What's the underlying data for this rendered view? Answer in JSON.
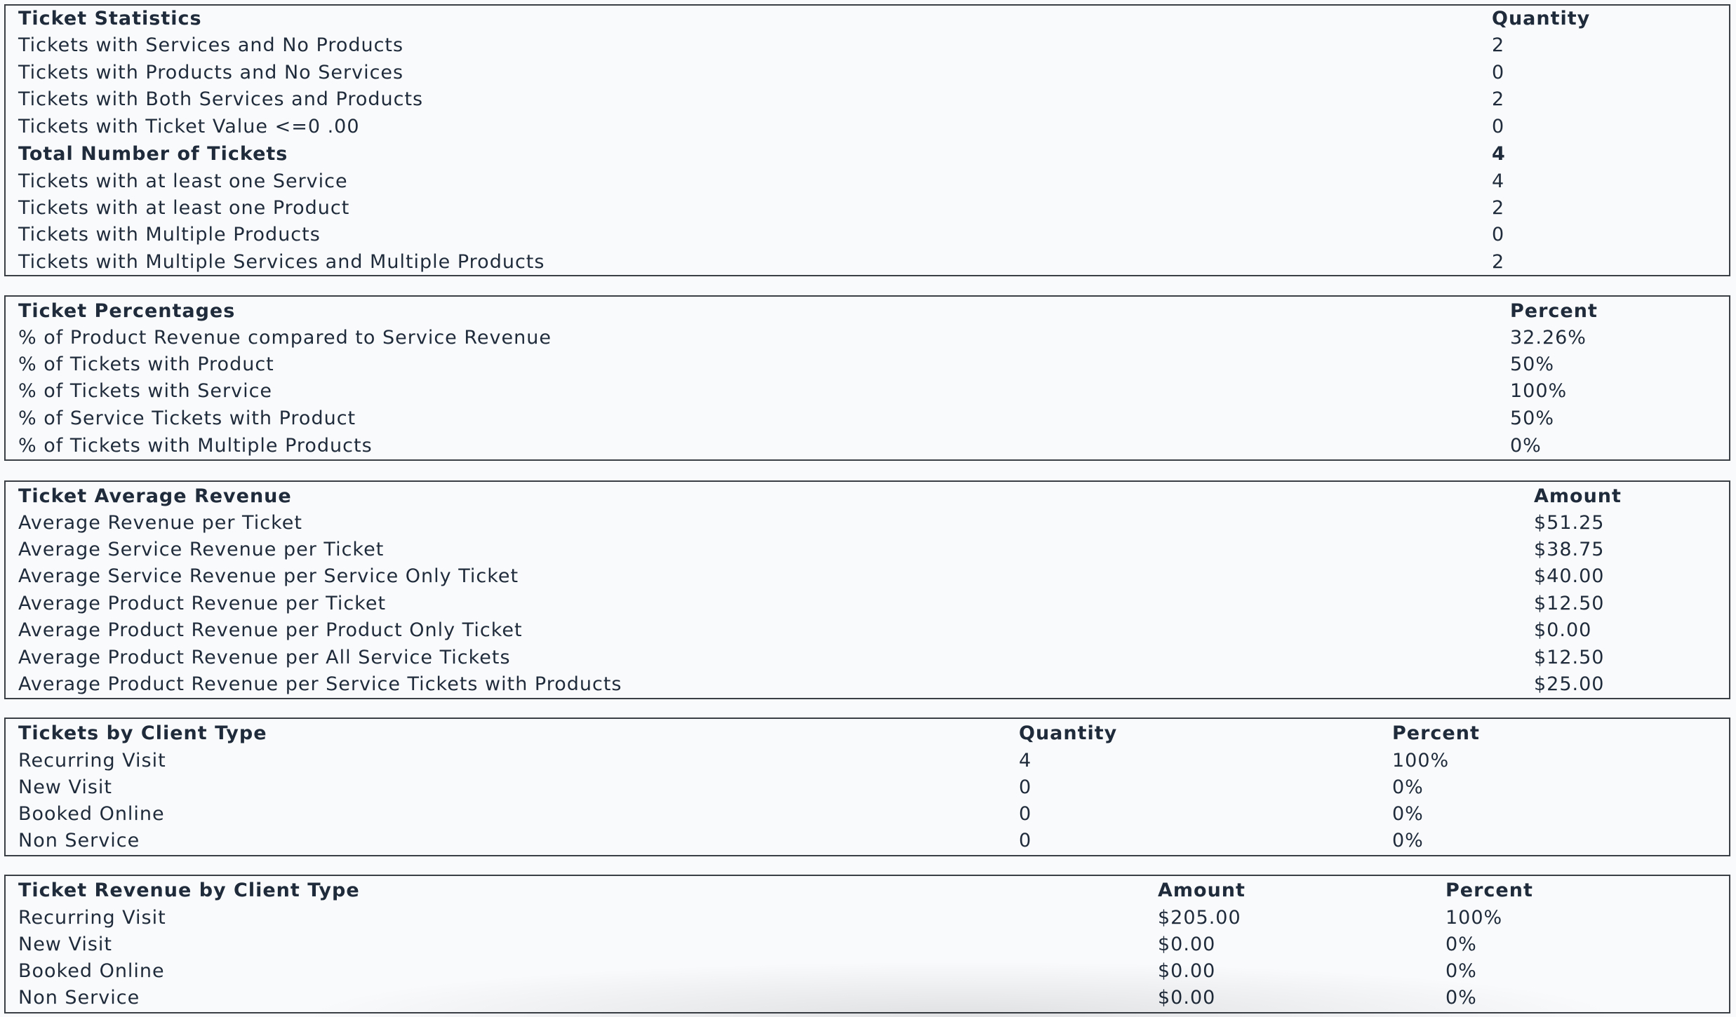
{
  "ticket_statistics": {
    "header": {
      "label": "Ticket Statistics",
      "value": "Quantity"
    },
    "rows": [
      {
        "label": "Tickets with Services and No Products",
        "value": "2"
      },
      {
        "label": "Tickets with Products and No Services",
        "value": "0"
      },
      {
        "label": "Tickets with Both Services and Products",
        "value": "2"
      },
      {
        "label": "Tickets with Ticket Value <=0 .00",
        "value": "0"
      },
      {
        "label": "Total Number of Tickets",
        "value": "4"
      },
      {
        "label": "Tickets with at least one Service",
        "value": "4"
      },
      {
        "label": "Tickets with at least one Product",
        "value": "2"
      },
      {
        "label": "Tickets with Multiple Products",
        "value": "0"
      },
      {
        "label": "Tickets with Multiple Services and Multiple Products",
        "value": "2"
      }
    ]
  },
  "ticket_percentages": {
    "header": {
      "label": "Ticket Percentages",
      "value": "Percent"
    },
    "rows": [
      {
        "label": "% of Product Revenue compared to Service Revenue",
        "value": "32.26%"
      },
      {
        "label": "% of Tickets with Product",
        "value": "50%"
      },
      {
        "label": "% of Tickets with Service",
        "value": "100%"
      },
      {
        "label": "% of Service Tickets with Product",
        "value": "50%"
      },
      {
        "label": "% of Tickets with Multiple Products",
        "value": "0%"
      }
    ]
  },
  "ticket_average_revenue": {
    "header": {
      "label": "Ticket Average Revenue",
      "value": "Amount"
    },
    "rows": [
      {
        "label": "Average Revenue per Ticket",
        "value": "$51.25"
      },
      {
        "label": "Average Service Revenue per Ticket",
        "value": "$38.75"
      },
      {
        "label": "Average Service Revenue per Service Only Ticket",
        "value": "$40.00"
      },
      {
        "label": "Average Product Revenue per Ticket",
        "value": "$12.50"
      },
      {
        "label": "Average Product Revenue per Product Only Ticket",
        "value": "$0.00"
      },
      {
        "label": "Average Product Revenue per All Service Tickets",
        "value": "$12.50"
      },
      {
        "label": "Average Product Revenue per Service Tickets with Products",
        "value": "$25.00"
      }
    ]
  },
  "tickets_by_client_type": {
    "header": {
      "label": "Tickets by Client Type",
      "quantity": "Quantity",
      "percent": "Percent"
    },
    "rows": [
      {
        "label": "Recurring Visit",
        "quantity": "4",
        "percent": "100%"
      },
      {
        "label": "New Visit",
        "quantity": "0",
        "percent": "0%"
      },
      {
        "label": "Booked Online",
        "quantity": "0",
        "percent": "0%"
      },
      {
        "label": "Non Service",
        "quantity": "0",
        "percent": "0%"
      }
    ]
  },
  "ticket_revenue_by_client_type": {
    "header": {
      "label": "Ticket Revenue by Client Type",
      "amount": "Amount",
      "percent": "Percent"
    },
    "rows": [
      {
        "label": "Recurring Visit",
        "amount": "$205.00",
        "percent": "100%"
      },
      {
        "label": "New Visit",
        "amount": "$0.00",
        "percent": "0%"
      },
      {
        "label": "Booked Online",
        "amount": "$0.00",
        "percent": "0%"
      },
      {
        "label": "Non Service",
        "amount": "$0.00",
        "percent": "0%"
      }
    ]
  }
}
